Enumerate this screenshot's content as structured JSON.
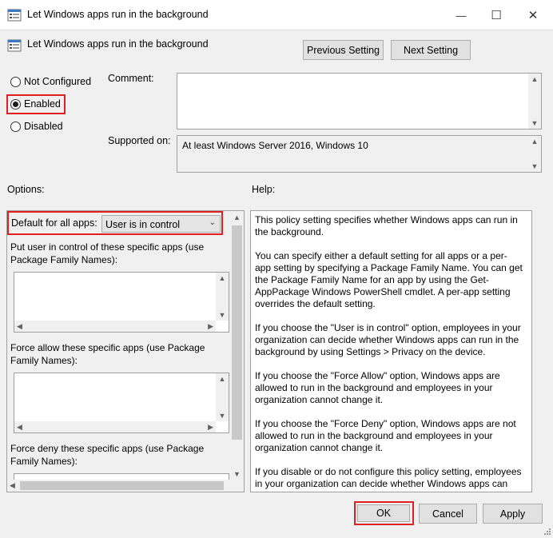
{
  "window": {
    "title": "Let Windows apps run in the background",
    "minimize_glyph": "—",
    "maximize_glyph": "☐",
    "close_glyph": "✕"
  },
  "header": {
    "policy_title": "Let Windows apps run in the background",
    "prev_button": "Previous Setting",
    "next_button": "Next Setting"
  },
  "state": {
    "not_configured": "Not Configured",
    "enabled": "Enabled",
    "disabled": "Disabled",
    "selected": "enabled"
  },
  "comment": {
    "label": "Comment:",
    "value": ""
  },
  "supported": {
    "label": "Supported on:",
    "value": "At least Windows Server 2016, Windows 10"
  },
  "options": {
    "label": "Options:",
    "default_label": "Default for all apps:",
    "default_value": "User is in control",
    "user_control_label": "Put user in control of these specific apps (use Package Family Names):",
    "force_allow_label": "Force allow these specific apps (use Package Family Names):",
    "force_deny_label": "Force deny these specific apps (use Package Family Names):"
  },
  "help": {
    "label": "Help:",
    "paragraphs": [
      "This policy setting specifies whether Windows apps can run in the background.",
      "You can specify either a default setting for all apps or a per-app setting by specifying a Package Family Name. You can get the Package Family Name for an app by using the Get-AppPackage Windows PowerShell cmdlet. A per-app setting overrides the default setting.",
      "If you choose the \"User is in control\" option, employees in your organization can decide whether Windows apps can run in the background by using Settings > Privacy on the device.",
      "If you choose the \"Force Allow\" option, Windows apps are allowed to run in the background and employees in your organization cannot change it.",
      "If you choose the \"Force Deny\" option, Windows apps are not allowed to run in the background and employees in your organization cannot change it.",
      "If you disable or do not configure this policy setting, employees in your organization can decide whether Windows apps can run"
    ]
  },
  "footer": {
    "ok": "OK",
    "cancel": "Cancel",
    "apply": "Apply"
  },
  "colors": {
    "highlight": "#e02020",
    "button_face": "#e1e1e1",
    "window_bg": "#f0f0f0"
  },
  "icons": {
    "title_icon": "policy-setting-icon",
    "header_icon": "policy-setting-icon"
  }
}
